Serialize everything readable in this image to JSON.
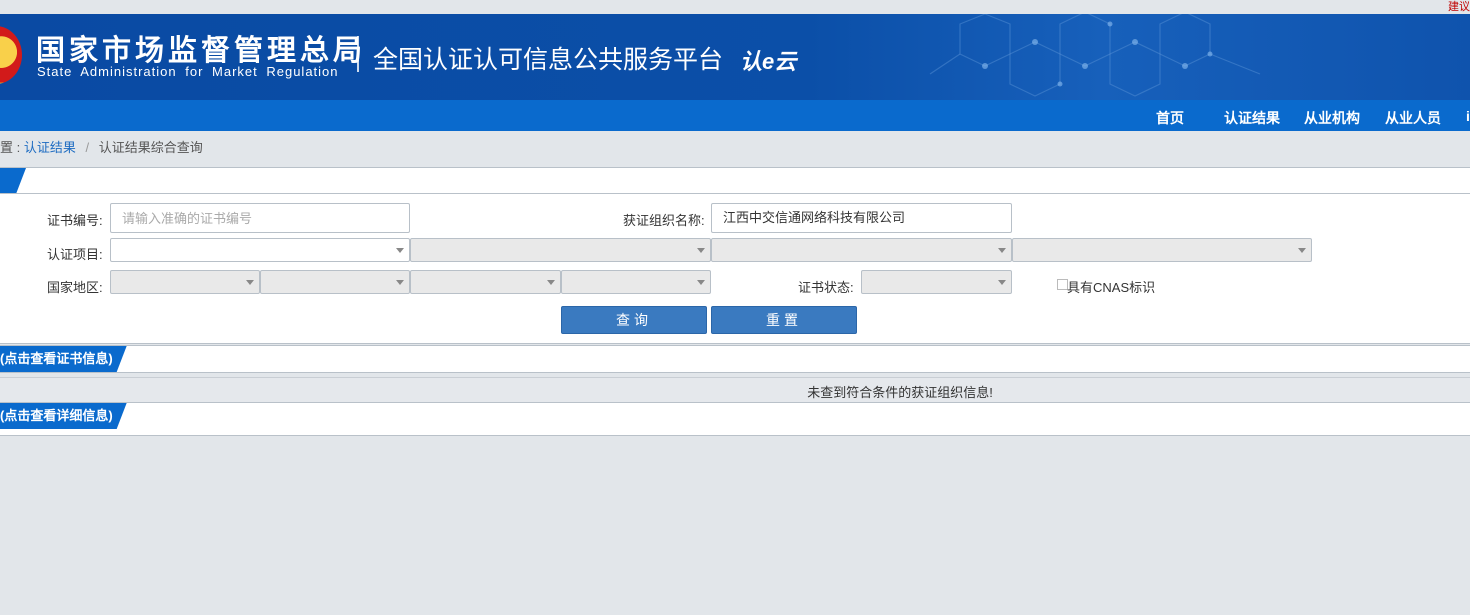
{
  "topbar": {
    "suggest_text": "建议"
  },
  "header": {
    "org_name_cn": "国家市场监督管理总局",
    "org_name_en": "State Administration  for  Market Regulation",
    "platform_title": "全国认证认可信息公共服务平台",
    "logo_text": "认e云"
  },
  "nav": {
    "items": [
      {
        "label": "首页"
      },
      {
        "label": "认证结果"
      },
      {
        "label": "从业机构"
      },
      {
        "label": "从业人员"
      },
      {
        "label": "i"
      }
    ]
  },
  "breadcrumb": {
    "prefix": "置 :",
    "link": "认证结果",
    "current": "认证结果综合查询"
  },
  "search": {
    "cert_no_label": "证书编号:",
    "cert_no_placeholder": "请输入准确的证书编号",
    "org_name_label": "获证组织名称:",
    "org_name_value": "江西中交信通网络科技有限公司",
    "project_label": "认证项目:",
    "region_label": "国家地区:",
    "status_label": "证书状态:",
    "cnas_label": "具有CNAS标识",
    "query_button": "查询",
    "reset_button": "重置"
  },
  "sections": {
    "cert_info": "(点击查看证书信息)",
    "no_result": "未查到符合条件的获证组织信息!",
    "detail_info": "(点击查看详细信息)"
  },
  "colors": {
    "banner": "#0b4fa8",
    "nav": "#0a6acd",
    "button": "#3a7ac0",
    "link": "#1e6cc2",
    "page_bg": "#e2e6ea"
  }
}
